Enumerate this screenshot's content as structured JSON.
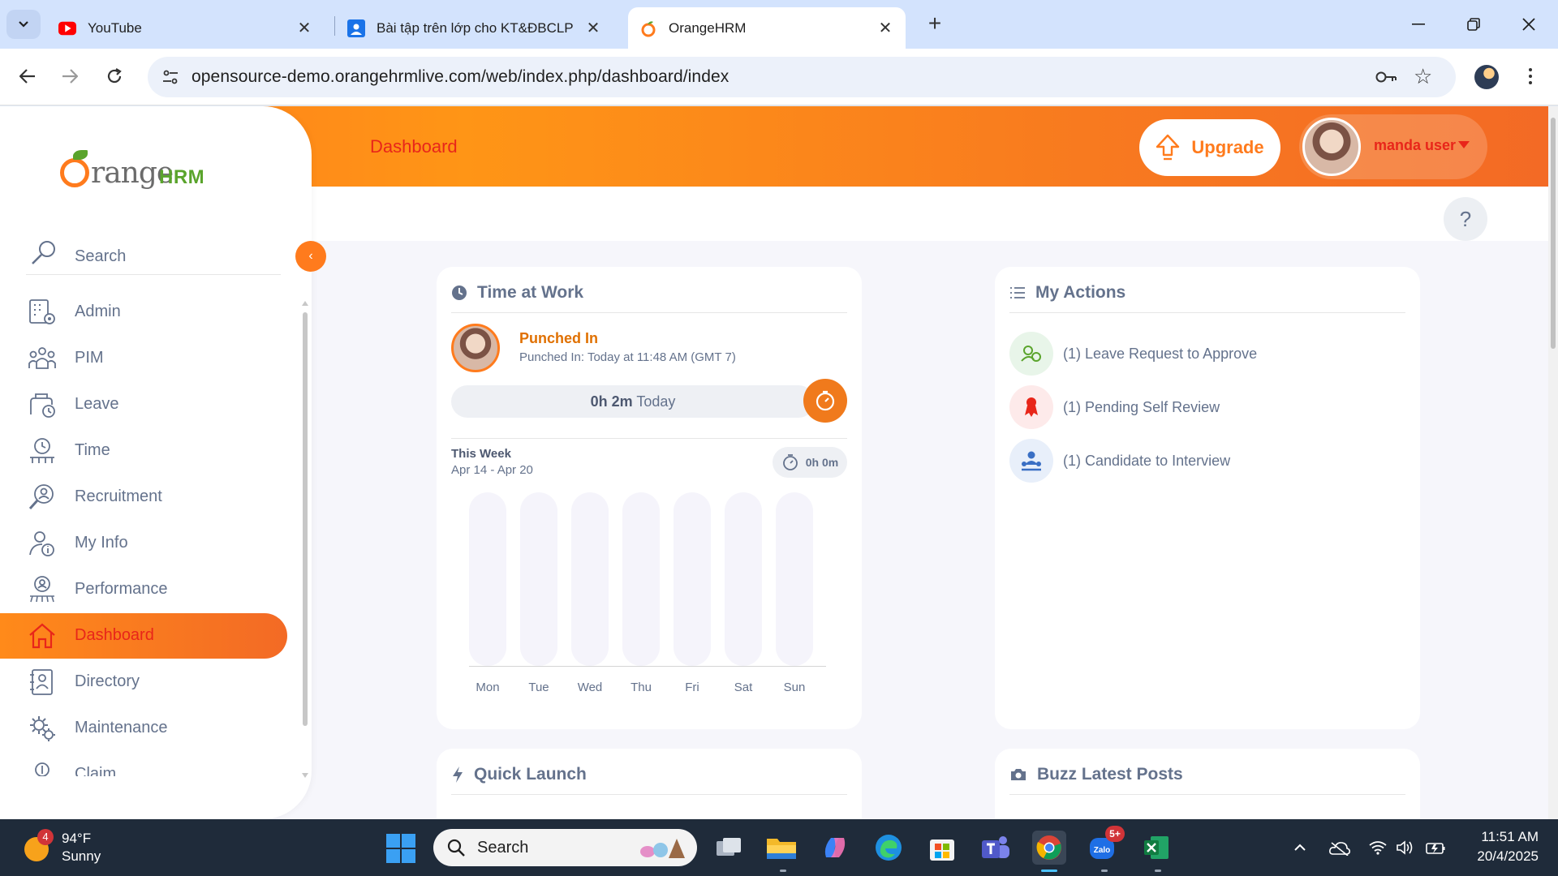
{
  "browser": {
    "tabs": [
      {
        "title": "YouTube",
        "icon": "youtube-icon",
        "active": false
      },
      {
        "title": "Bài tập trên lớp cho KT&ĐBCLP",
        "icon": "classroom-icon",
        "active": false
      },
      {
        "title": "OrangeHRM",
        "icon": "orangehrm-icon",
        "active": true
      }
    ],
    "url": "opensource-demo.orangehrmlive.com/web/index.php/dashboard/index"
  },
  "header": {
    "title": "Dashboard",
    "upgrade_label": "Upgrade",
    "user_name": "manda user",
    "help_label": "?"
  },
  "sidebar": {
    "logo_text": "range",
    "logo_suffix": "HRM",
    "search_label": "Search",
    "collapse_label": "‹",
    "items": [
      {
        "label": "Admin",
        "icon": "admin-icon"
      },
      {
        "label": "PIM",
        "icon": "pim-icon"
      },
      {
        "label": "Leave",
        "icon": "leave-icon"
      },
      {
        "label": "Time",
        "icon": "time-icon"
      },
      {
        "label": "Recruitment",
        "icon": "recruitment-icon"
      },
      {
        "label": "My Info",
        "icon": "my-info-icon"
      },
      {
        "label": "Performance",
        "icon": "performance-icon"
      },
      {
        "label": "Dashboard",
        "icon": "home-icon",
        "active": true
      },
      {
        "label": "Directory",
        "icon": "directory-icon"
      },
      {
        "label": "Maintenance",
        "icon": "maintenance-icon"
      },
      {
        "label": "Claim",
        "icon": "claim-icon"
      }
    ]
  },
  "time_at_work": {
    "title": "Time at Work",
    "status": "Punched In",
    "detail": "Punched In: Today at 11:48 AM (GMT 7)",
    "today_value": "0h 2m",
    "today_suffix": "Today",
    "week_title": "This Week",
    "week_range": "Apr 14 - Apr 20",
    "week_total": "0h 0m"
  },
  "chart_data": {
    "type": "bar",
    "categories": [
      "Mon",
      "Tue",
      "Wed",
      "Thu",
      "Fri",
      "Sat",
      "Sun"
    ],
    "values": [
      0,
      0,
      0,
      0,
      0,
      0,
      0
    ],
    "title": "",
    "xlabel": "",
    "ylabel": ""
  },
  "my_actions": {
    "title": "My Actions",
    "items": [
      {
        "label": "(1) Leave Request to Approve",
        "icon": "leave-request-icon",
        "color": "#e8f5e9"
      },
      {
        "label": "(1) Pending Self Review",
        "icon": "self-review-icon",
        "color": "#fdeaea"
      },
      {
        "label": "(1) Candidate to Interview",
        "icon": "candidate-icon",
        "color": "#e8effa"
      }
    ]
  },
  "quick_launch": {
    "title": "Quick Launch"
  },
  "buzz": {
    "title": "Buzz Latest Posts"
  },
  "taskbar": {
    "weather_badge": "4",
    "temperature": "94°F",
    "condition": "Sunny",
    "search_label": "Search",
    "time": "11:51 AM",
    "date": "20/4/2025",
    "zalo_badge": "5+",
    "apps": [
      "task-view-icon",
      "file-explorer-icon",
      "copilot-icon",
      "edge-icon",
      "store-icon",
      "teams-icon",
      "chrome-icon",
      "zalo-icon",
      "excel-icon"
    ]
  },
  "colors": {
    "brand_orange": "#ff7b1d",
    "active_text": "#e8261a",
    "muted_text": "#64728c"
  }
}
